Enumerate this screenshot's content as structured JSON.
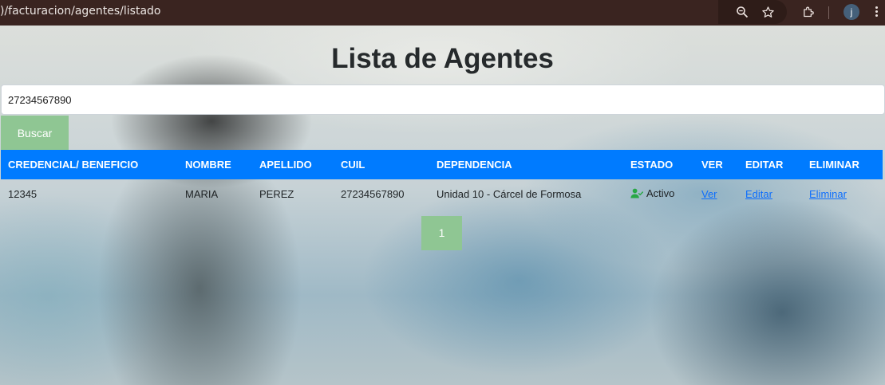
{
  "browser": {
    "url": ")/facturacion/agentes/listado",
    "profile_initial": "j",
    "icons": [
      "zoom-icon",
      "star-icon",
      "extensions-icon",
      "profile-avatar",
      "menu-icon"
    ]
  },
  "page": {
    "title": "Lista de Agentes",
    "search": {
      "value": "27234567890",
      "button_label": "Buscar"
    },
    "table": {
      "headers": [
        "CREDENCIAL/ BENEFICIO",
        "NOMBRE",
        "APELLIDO",
        "CUIL",
        "DEPENDENCIA",
        "ESTADO",
        "VER",
        "EDITAR",
        "ELIMINAR"
      ],
      "rows": [
        {
          "credencial": "12345",
          "nombre": "MARIA",
          "apellido": "PEREZ",
          "cuil": "27234567890",
          "dependencia": "Unidad 10 - Cárcel de Formosa",
          "estado": "Activo",
          "ver": "Ver",
          "editar": "Editar",
          "eliminar": "Eliminar"
        }
      ]
    },
    "pagination": {
      "current_page": "1"
    }
  },
  "colors": {
    "header_blue": "#007bff",
    "button_green": "#8fc693",
    "active_green": "#28a745",
    "link_blue": "#0d6efd"
  }
}
